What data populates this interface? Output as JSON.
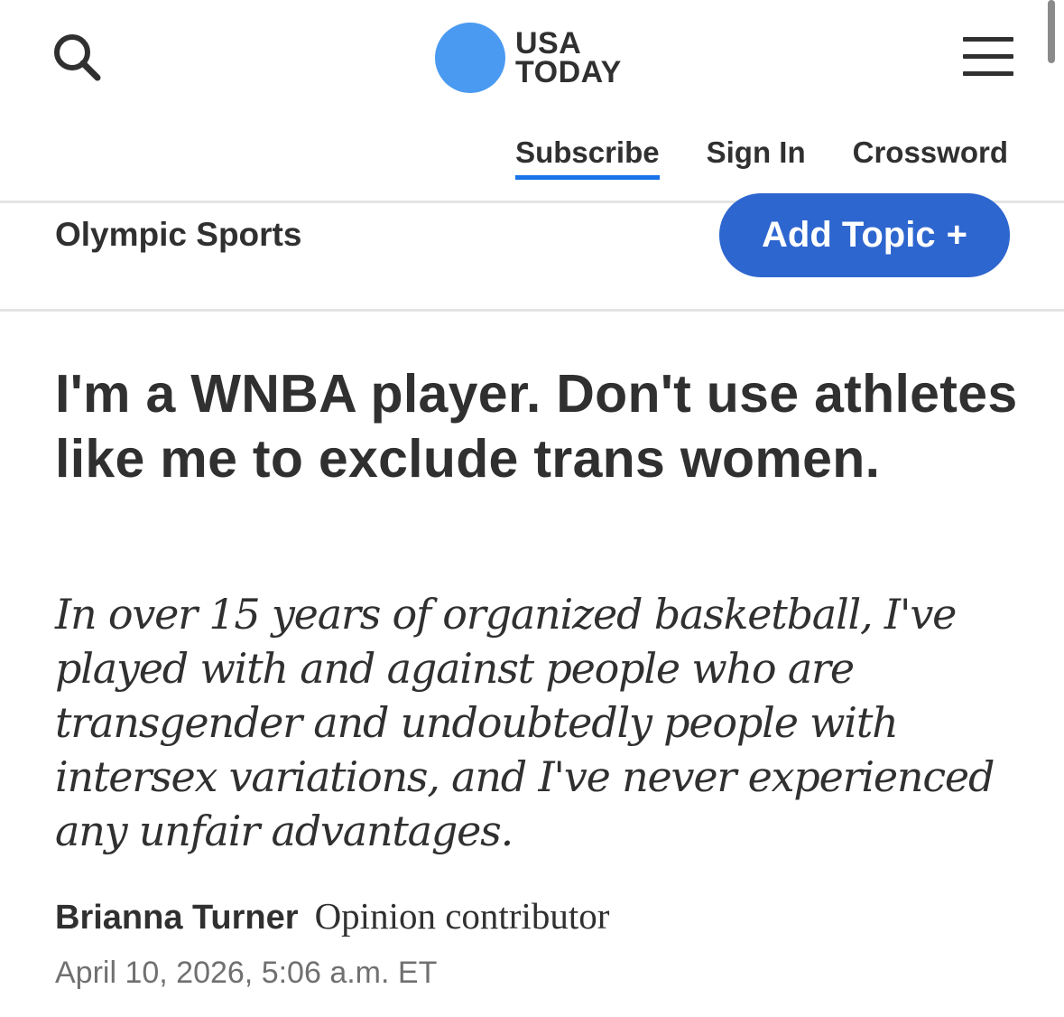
{
  "header": {
    "logo": {
      "line1": "USA",
      "line2": "TODAY",
      "dot_color": "#4a9af1"
    },
    "search_icon": "search-icon",
    "menu_icon": "hamburger-menu-icon",
    "nav": {
      "subscribe": "Subscribe",
      "sign_in": "Sign In",
      "crossword": "Crossword"
    },
    "accent_color": "#1a73e8"
  },
  "topic_bar": {
    "topic": "Olympic Sports",
    "add_topic_label": "Add Topic",
    "add_topic_plus": "+",
    "button_color": "#2e66cf"
  },
  "article": {
    "headline": "I'm a WNBA player. Don't use athletes like me to exclude trans women.",
    "dek": "In over 15 years of organized basketball, I've played with and against people who are transgender and undoubtedly people with intersex variations, and I've never experienced any unfair advantages.",
    "author": "Brianna Turner",
    "author_role": "Opinion contributor",
    "date": "April 10, 2026, 5:06 a.m. ET"
  }
}
